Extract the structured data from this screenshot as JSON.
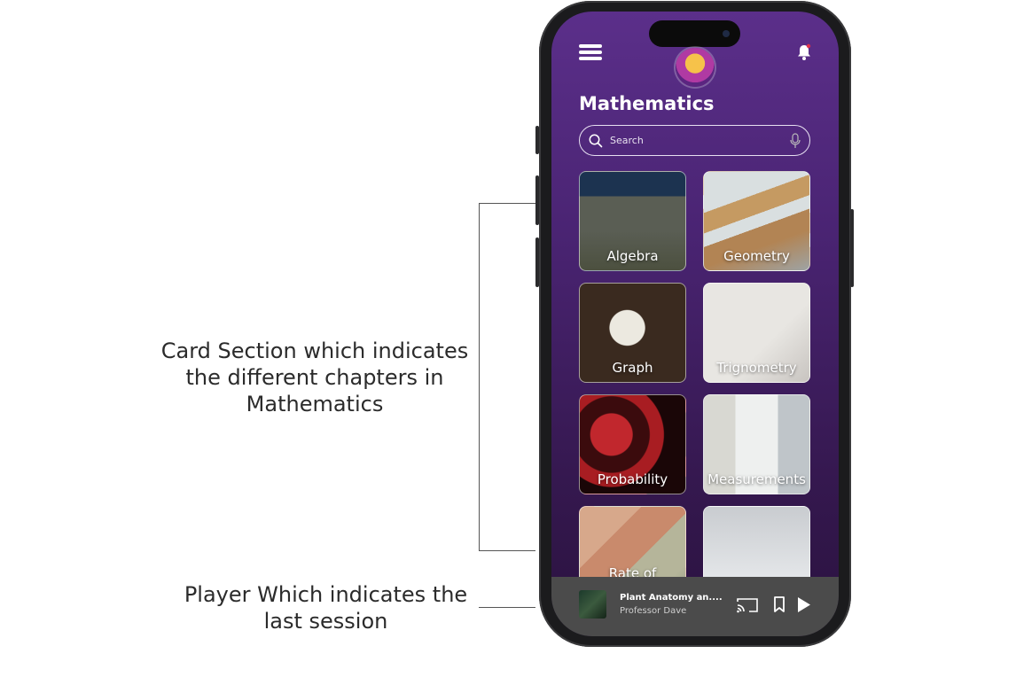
{
  "annotations": {
    "cards": "Card Section which indicates the different chapters in Mathematics",
    "player": "Player Which indicates the last session"
  },
  "header": {
    "menu_icon": "hamburger-menu-icon",
    "notification_icon": "bell-icon",
    "avatar_icon": "kid-avatar"
  },
  "page": {
    "title": "Mathematics"
  },
  "search": {
    "placeholder": "Search",
    "search_icon": "search-icon",
    "mic_icon": "microphone-icon"
  },
  "chapters": [
    {
      "label": "Algebra"
    },
    {
      "label": "Geometry"
    },
    {
      "label": "Graph"
    },
    {
      "label": "Trignometry"
    },
    {
      "label": "Probability"
    },
    {
      "label": "Measurements"
    },
    {
      "label": "Rate of"
    },
    {
      "label": ""
    }
  ],
  "player": {
    "title": "Plant Anatomy an....",
    "author": "Professor Dave",
    "cast_icon": "cast-icon",
    "bookmark_icon": "bookmark-icon",
    "play_icon": "play-icon"
  },
  "colors": {
    "screen_top": "#5b2f8a",
    "screen_bottom": "#2a123f",
    "player_bg": "#4b4b4b",
    "notification_dot": "#e0304b"
  }
}
